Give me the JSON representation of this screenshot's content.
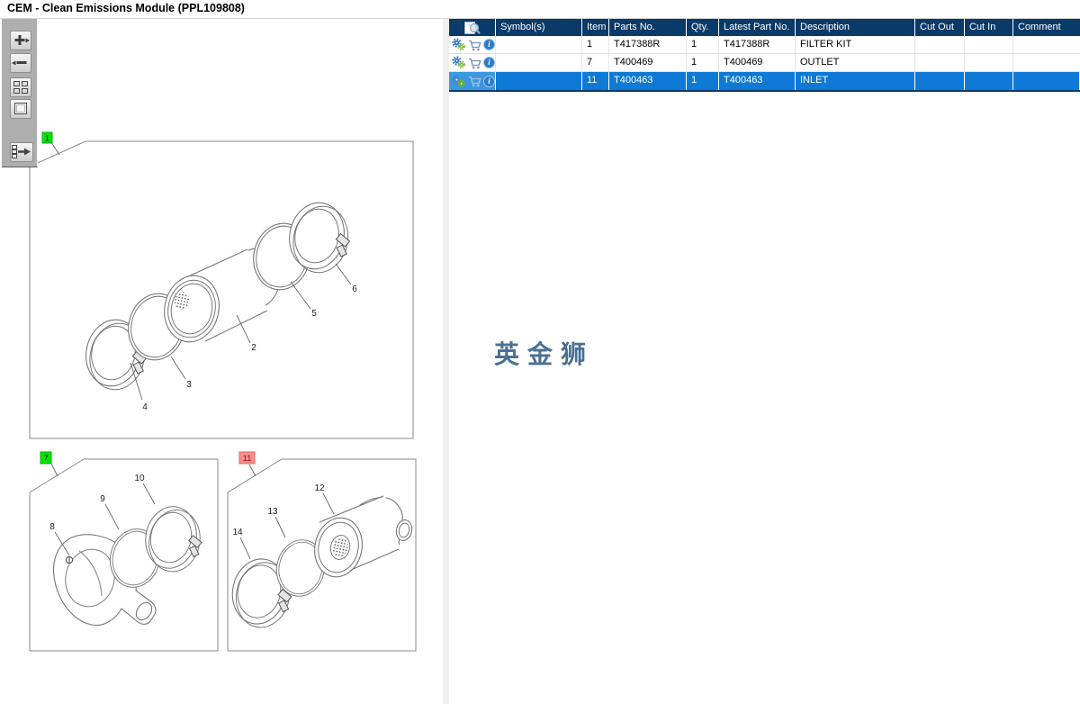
{
  "window": {
    "title": "CEM - Clean Emissions Module (PPL109808)"
  },
  "toolbar": {
    "buttons": [
      {
        "icon": "zoom-in-icon"
      },
      {
        "icon": "zoom-out-icon"
      },
      {
        "icon": "tile-view-icon"
      },
      {
        "icon": "fit-view-icon"
      },
      {
        "icon": "toggle-panel-icon"
      }
    ]
  },
  "diagrams": [
    {
      "label": "1",
      "label_color": "#00e800",
      "callouts": [
        "2",
        "3",
        "4",
        "5",
        "6"
      ]
    },
    {
      "label": "7",
      "label_color": "#00e800",
      "callouts": [
        "8",
        "9",
        "10"
      ]
    },
    {
      "label": "11",
      "label_color": "#f98c8c",
      "callouts": [
        "12",
        "13",
        "14"
      ]
    }
  ],
  "watermark": {
    "text": "英金狮",
    "color": "#4a7096"
  },
  "table": {
    "header_icon": "preview-document-icon",
    "row_icons": [
      "parts-gears-icon",
      "cart-icon",
      "info-icon"
    ],
    "columns": [
      "Symbol(s)",
      "Item",
      "Parts No.",
      "Qty.",
      "Latest Part No.",
      "Description",
      "Cut Out",
      "Cut In",
      "Comment"
    ],
    "rows": [
      {
        "selected": false,
        "symbols": "",
        "item": "1",
        "parts_no": "T417388R",
        "qty": "1",
        "latest_part_no": "T417388R",
        "description": "FILTER KIT",
        "cut_out": "",
        "cut_in": "",
        "comment": ""
      },
      {
        "selected": false,
        "symbols": "",
        "item": "7",
        "parts_no": "T400469",
        "qty": "1",
        "latest_part_no": "T400469",
        "description": "OUTLET",
        "cut_out": "",
        "cut_in": "",
        "comment": ""
      },
      {
        "selected": true,
        "symbols": "",
        "item": "11",
        "parts_no": "T400463",
        "qty": "1",
        "latest_part_no": "T400463",
        "description": "INLET",
        "cut_out": "",
        "cut_in": "",
        "comment": ""
      }
    ],
    "colors": {
      "header_bg": "#0a3a68",
      "selected_bg": "#0e7ad6",
      "selected_first_cell_bg": "#3b97e2"
    }
  }
}
